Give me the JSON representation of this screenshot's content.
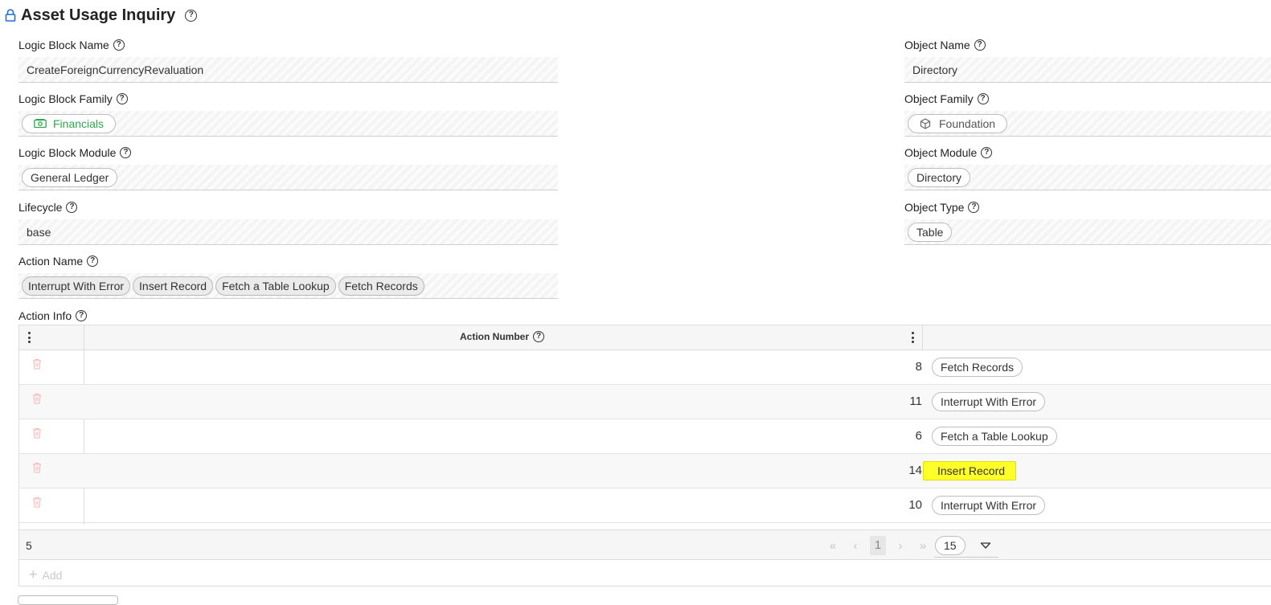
{
  "page": {
    "title": "Asset Usage Inquiry"
  },
  "fields": {
    "logic_block_name": {
      "label": "Logic Block Name",
      "value": "CreateForeignCurrencyRevaluation"
    },
    "logic_block_family": {
      "label": "Logic Block Family",
      "value": "Financials"
    },
    "logic_block_module": {
      "label": "Logic Block Module",
      "value": "General Ledger"
    },
    "lifecycle": {
      "label": "Lifecycle",
      "value": "base"
    },
    "action_name": {
      "label": "Action Name",
      "values": [
        "Interrupt With Error",
        "Insert Record",
        "Fetch a Table Lookup",
        "Fetch Records"
      ]
    },
    "object_name": {
      "label": "Object Name",
      "value": "Directory"
    },
    "object_family": {
      "label": "Object Family",
      "value": "Foundation"
    },
    "object_module": {
      "label": "Object Module",
      "value": "Directory"
    },
    "object_type": {
      "label": "Object Type",
      "value": "Table"
    }
  },
  "action_info": {
    "label": "Action Info",
    "column_header": "Action Number",
    "rows": [
      {
        "number": "8",
        "action": "Fetch Records"
      },
      {
        "number": "11",
        "action": "Interrupt With Error"
      },
      {
        "number": "6",
        "action": "Fetch a Table Lookup"
      },
      {
        "number": "14",
        "action": "Insert Record",
        "highlighted": true
      },
      {
        "number": "10",
        "action": "Interrupt With Error"
      }
    ],
    "record_count": "5",
    "current_page": "1",
    "page_size": "15",
    "add_label": "Add"
  },
  "colors": {
    "family_green": "#2ea84a",
    "highlight_yellow": "#ffff2a",
    "lock_blue": "#1e6fd9",
    "trash_red": "#f2b6b6"
  },
  "icons": [
    "lock-icon",
    "help-icon",
    "money-icon",
    "cube-icon",
    "kebab-icon",
    "trash-icon",
    "first-page-icon",
    "prev-page-icon",
    "next-page-icon",
    "last-page-icon",
    "dropdown-icon",
    "plus-icon"
  ]
}
